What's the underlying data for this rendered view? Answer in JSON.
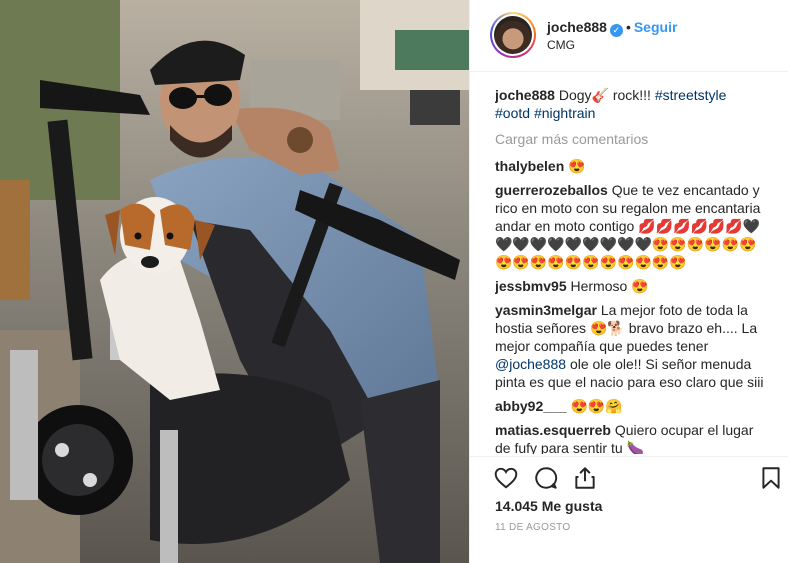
{
  "post": {
    "author": "joche888",
    "separator": "•",
    "follow_label": "Seguir",
    "location": "CMG",
    "caption_text": "Dogy🎸 rock!!!",
    "caption_tags": [
      "#streetstyle",
      "#ootd",
      "#nightrain"
    ],
    "load_more_label": "Cargar más comentarios",
    "likes": "14.045 Me gusta",
    "date": "11 DE AGOSTO"
  },
  "comments": [
    {
      "user": "thalybelen",
      "text": "😍"
    },
    {
      "user": "guerrerozeballos",
      "text": "Que te vez encantado y rico en moto con su regalon me encantaria andar en moto contigo 💋💋💋💋💋💋🖤🖤🖤🖤🖤🖤🖤🖤🖤🖤😍😍😍😍😍😍😍😍😍😍😍😍😍😍😍😍😍"
    },
    {
      "user": "jessbmv95",
      "text": "Hermoso 😍"
    },
    {
      "user": "yasmin3melgar",
      "text_before": "La mejor foto de toda la hostia señores 😍🐕 bravo brazo eh.... La mejor compañía que puedes tener",
      "mention": "@joche888",
      "text_after": "ole ole ole!! Si señor menuda pinta es que el nacio para eso claro que siii"
    },
    {
      "user": "abby92___",
      "text": "😍😍🤗"
    },
    {
      "user": "matias.esquerreb",
      "text": "Quiero ocupar el lugar de fufy para sentir tu 🍆"
    }
  ],
  "icons": {
    "like": "heart-icon",
    "comment": "comment-icon",
    "share": "share-icon",
    "save": "bookmark-icon",
    "verified": "verified-badge-icon"
  },
  "colors": {
    "link_blue": "#3897f0",
    "hashtag": "#003569",
    "muted": "#999999",
    "text": "#262626"
  }
}
